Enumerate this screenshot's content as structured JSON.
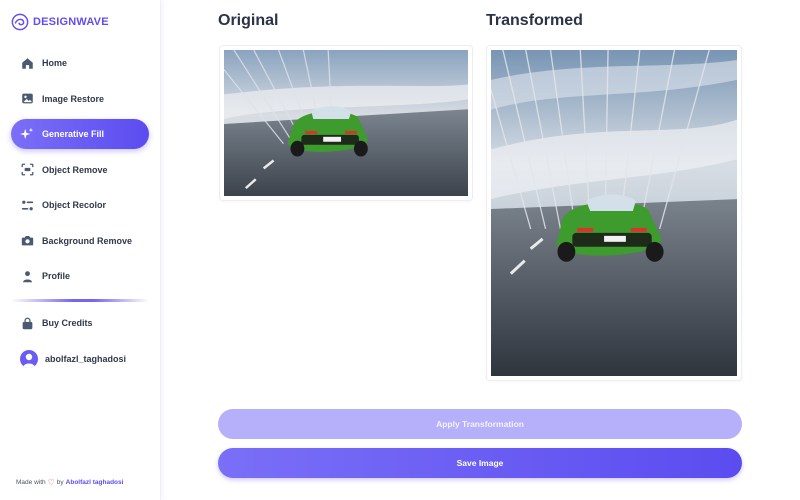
{
  "brand": {
    "name": "DESIGNWAVE",
    "sub": "",
    "color": "#624cf5"
  },
  "nav": [
    {
      "label": "Home",
      "icon": "home-icon",
      "active": false
    },
    {
      "label": "Image Restore",
      "icon": "image-icon",
      "active": false
    },
    {
      "label": "Generative Fill",
      "icon": "sparkles-icon",
      "active": true
    },
    {
      "label": "Object Remove",
      "icon": "scan-icon",
      "active": false
    },
    {
      "label": "Object Recolor",
      "icon": "filter-icon",
      "active": false
    },
    {
      "label": "Background Remove",
      "icon": "camera-icon",
      "active": false
    },
    {
      "label": "Profile",
      "icon": "user-icon",
      "active": false
    }
  ],
  "nav_secondary": [
    {
      "label": "Buy Credits",
      "icon": "bag-icon"
    }
  ],
  "user": {
    "name": "abolfazl_taghadosi"
  },
  "footer": {
    "made_with": "Made with",
    "by": "by",
    "author": "Abolfazl taghadosi"
  },
  "main": {
    "original_title": "Original",
    "transformed_title": "Transformed",
    "apply_label": "Apply Transformation",
    "save_label": "Save Image"
  },
  "colors": {
    "accent": "#5b4cf0",
    "accent_light": "#b6aff9",
    "text": "#2b3346"
  }
}
